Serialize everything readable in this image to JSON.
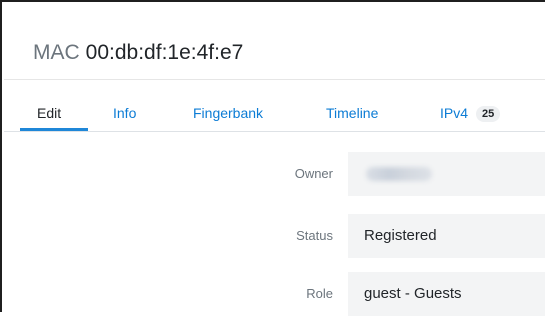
{
  "header": {
    "prefix": "MAC",
    "mac_address": "00:db:df:1e:4f:e7"
  },
  "tabs": [
    {
      "label": "Edit",
      "active": true
    },
    {
      "label": "Info",
      "active": false
    },
    {
      "label": "Fingerbank",
      "active": false
    },
    {
      "label": "Timeline",
      "active": false
    },
    {
      "label": "IPv4",
      "active": false,
      "badge": "25"
    }
  ],
  "form": {
    "owner": {
      "label": "Owner",
      "value_redacted": true
    },
    "status": {
      "label": "Status",
      "value": "Registered"
    },
    "role": {
      "label": "Role",
      "value": "guest - Guests"
    }
  },
  "colors": {
    "link": "#0c7cd5",
    "active_underline": "#1f87d8",
    "field_background": "#f3f4f5",
    "label_text": "#6c757d"
  }
}
